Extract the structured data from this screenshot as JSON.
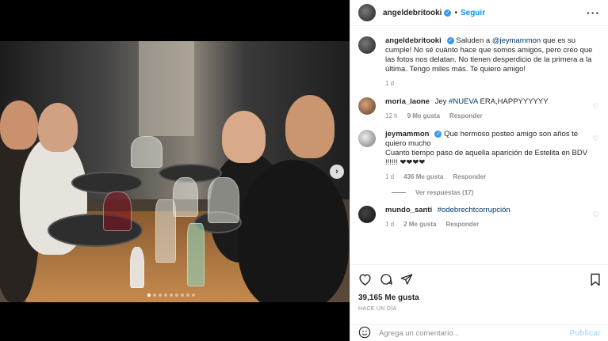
{
  "post": {
    "username": "angeldebritooki",
    "follow_label": "Seguir",
    "more_icon": "more-horizontal-icon",
    "caption_user": "angeldebritooki",
    "caption_text_1": "Saluden a ",
    "caption_mention": "@jeymammon",
    "caption_text_2": " que es su cumple! No sé cuánto hace que somos amigos, pero creo que las fotos nos delatan. No tienen desperdicio de la primera a la última. Tengo miles más. Te quiero amigo!",
    "caption_age": "1 d",
    "carousel": {
      "slides": 9,
      "active": 0
    }
  },
  "comments": [
    {
      "user": "moria_laone",
      "text_1": "Jey ",
      "tag": "#NUEVA",
      "text_2": " ERA,HAPPYYYYYY",
      "age": "12 h",
      "likes": "9 Me gusta",
      "reply": "Responder"
    },
    {
      "user": "jeymammon",
      "text": "Que hermoso posteo amigo son años te quiero mucho\nCuanto tiempo paso de aquella aparición de Estelita en BDV !!!!!! ❤❤❤❤",
      "age": "1 d",
      "likes": "436 Me gusta",
      "reply": "Responder",
      "view_replies": "Ver respuestas (17)"
    },
    {
      "user": "mundo_santi",
      "tag": "#odebrechtcorrupción",
      "age": "1 d",
      "likes": "2 Me gusta",
      "reply": "Responder"
    }
  ],
  "actions": {
    "likes": "39,165 Me gusta",
    "time": "HACE UN DÍA"
  },
  "composer": {
    "placeholder": "Agrega un comentario...",
    "publish_label": "Publicar"
  },
  "colors": {
    "accent": "#0095f6",
    "verified": "#3897f0",
    "publish_disabled": "#b2dffc",
    "muted": "#8e8e8e"
  }
}
